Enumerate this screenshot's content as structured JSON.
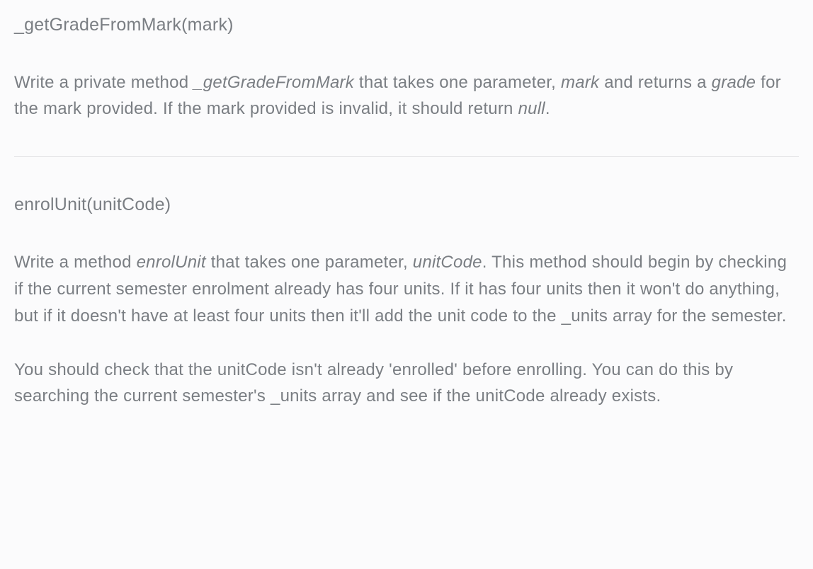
{
  "section1": {
    "signature": "_getGradeFromMark(mark)",
    "desc_part1": "Write a private method ",
    "desc_em1": "_getGradeFromMark",
    "desc_part2": " that takes one parameter, ",
    "desc_em2": "mark",
    "desc_part3": " and returns a ",
    "desc_em3": "grade",
    "desc_part4": " for the mark provided. If the mark provided is invalid, it should return ",
    "desc_em4": "null",
    "desc_part5": "."
  },
  "section2": {
    "signature": "enrolUnit(unitCode)",
    "p1_part1": "Write a method ",
    "p1_em1": "enrolUnit",
    "p1_part2": " that takes one parameter, ",
    "p1_em2": "unitCode",
    "p1_part3": ". This method should begin by checking if the current semester enrolment already has four units. If it has four units then it won't do anything, but if it doesn't have at least four units then it'll add the unit code to the _units array for the semester.",
    "p2": "You should check that the unitCode isn't already 'enrolled' before enrolling. You can do this by searching the current semester's _units array and see if the unitCode already exists."
  }
}
